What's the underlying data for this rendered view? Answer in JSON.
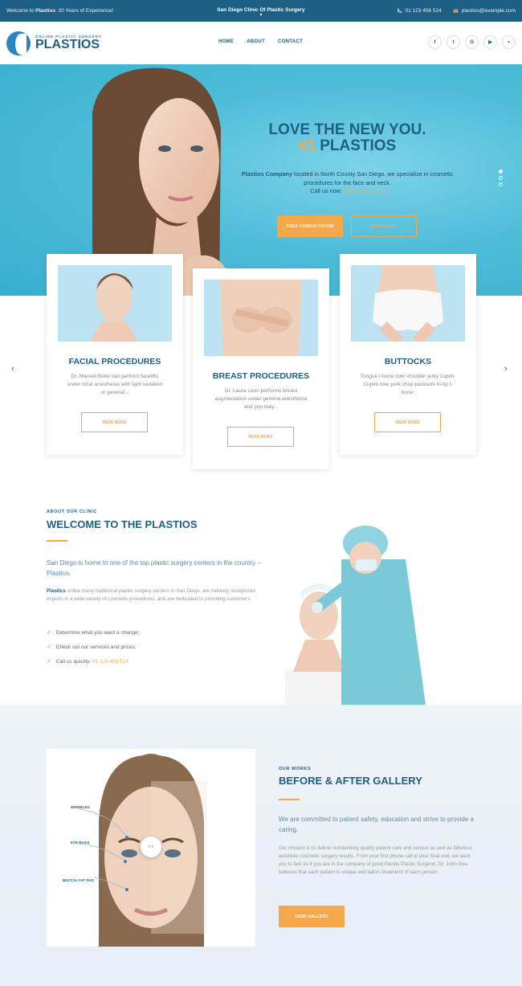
{
  "topbar": {
    "welcome_prefix": "Welcome to ",
    "welcome_brand": "Plastios",
    "welcome_suffix": ": 20 Years of Experience!",
    "center": "San Diego Clinic Of Plastic Surgery",
    "phone": "01 123 456 524",
    "email": "plastios@example.com",
    "phone_icon": "phone-icon",
    "email_icon": "envelope-icon"
  },
  "header": {
    "logo_tag": "ONLINE PLASTIC SURGERY",
    "logo_name": "PLASTIOS",
    "nav": [
      "HOME",
      "ABOUT",
      "CONTACT"
    ],
    "social": [
      {
        "icon": "facebook-icon",
        "glyph": "f"
      },
      {
        "icon": "twitter-icon",
        "glyph": "t"
      },
      {
        "icon": "google-icon",
        "glyph": "G"
      },
      {
        "icon": "youtube-icon",
        "glyph": "▶"
      },
      {
        "icon": "rss-icon",
        "glyph": "⌁"
      }
    ]
  },
  "hero": {
    "title_line1": "LOVE THE NEW YOU.",
    "title_num": "#1",
    "title_line2": " PLASTIOS",
    "company": "Plastios Company",
    "desc": " located in North County San Diego, we specialize in cosmetic procedures for the face and neck.",
    "call_label": "Call us now: ",
    "call_phone": "01 123 456 524",
    "btn_primary": "FREE CONSULTATION",
    "btn_secondary": "READ MORE",
    "slides": 3,
    "active_slide": 1
  },
  "cards": [
    {
      "title": "FACIAL PROCEDURES",
      "text": "Dr. Manuel Betel can perform facelifts under local anesthesia with light sedation or general...",
      "button": "READ MORE"
    },
    {
      "title": "BREAST PROCEDURES",
      "text": "Dr. Laura Leon performs breast augmentation under general anesthesia and you may...",
      "button": "READ MORE"
    },
    {
      "title": "BUTTOCKS",
      "text": "Tongue t-bone cow shoulder jerky cupim. Cupim cow pork chop pastrami tri-tip t-bone.",
      "button": "READ MORE"
    }
  ],
  "welcome": {
    "label": "ABOUT OUR CLINIC",
    "title": "WELCOME TO THE PLASTIOS",
    "lead": "San Diego is home to one of the top plastic surgery centers in the country – Plastios.",
    "body_brand": "Plastics",
    "body": " unlike many traditional plastic surgery centers in San Diego, are industry recognized experts in a wide variety of cosmetic procedures, and are dedicated to providing customers.",
    "checks": [
      "Determine what you want a change;",
      "Check out our services and prices;"
    ],
    "check_call_label": "Call us quickly: ",
    "check_call_phone": "01 123 456 524"
  },
  "gallery": {
    "label": "OUR WORKS",
    "title": "BEFORE & AFTER GALLERY",
    "lead": "We are committed to patient safety, education and strive to provide a caring.",
    "body": "Our mission is to deliver outstanding quality patient care and service as well as fabulous aesthetic cosmetic surgery results. From your first phone call to your final visit, we want you to feel as if you are in the company of good friends Plastic Surgeon, Dr. John Doe believes that each patient is unique and tailors treatment of each person.",
    "button": "VIEW GALLERY",
    "labels": [
      "WRINKLES",
      "EYE BAGS",
      "BUCCAL FAT PAD"
    ],
    "handle": "‹ ›"
  },
  "colors": {
    "primary": "#1d5f85",
    "accent": "#f4a84a",
    "hero_bg": "#4fbdd9"
  }
}
